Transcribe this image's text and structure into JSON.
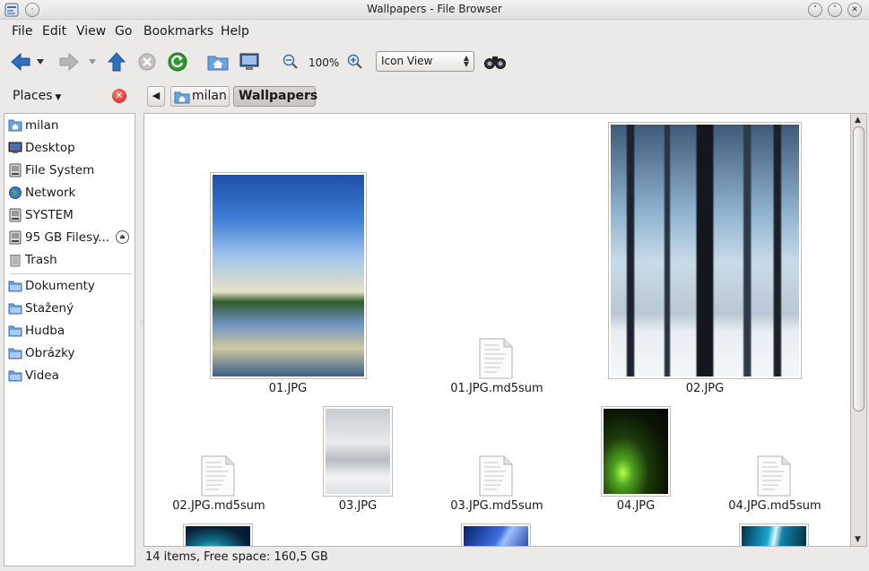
{
  "window": {
    "title": "Wallpapers - File Browser",
    "buttons": [
      "minimize",
      "maximize",
      "close"
    ]
  },
  "menubar": {
    "items": [
      "File",
      "Edit",
      "View",
      "Go",
      "Bookmarks",
      "Help"
    ]
  },
  "toolbar": {
    "zoom": "100%",
    "view_mode": "Icon View",
    "icons": [
      "back-icon",
      "back-history-icon",
      "forward-icon",
      "forward-history-icon",
      "up-icon",
      "stop-icon",
      "reload-icon",
      "home-icon",
      "computer-icon",
      "zoom-out-icon",
      "zoom-in-icon",
      "find-icon"
    ]
  },
  "places": {
    "header": "Places",
    "items": [
      {
        "label": "milan",
        "icon": "home-folder-icon"
      },
      {
        "label": "Desktop",
        "icon": "desktop-icon"
      },
      {
        "label": "File System",
        "icon": "drive-icon"
      },
      {
        "label": "Network",
        "icon": "network-icon"
      },
      {
        "label": "SYSTEM",
        "icon": "drive-icon"
      },
      {
        "label": "95 GB Filesy...",
        "icon": "drive-icon"
      },
      {
        "label": "Trash",
        "icon": "trash-icon"
      },
      {
        "label": "Dokumenty",
        "icon": "folder-icon"
      },
      {
        "label": "Stažený",
        "icon": "folder-icon"
      },
      {
        "label": "Hudba",
        "icon": "folder-icon"
      },
      {
        "label": "Obrázky",
        "icon": "folder-icon"
      },
      {
        "label": "Videa",
        "icon": "folder-icon"
      }
    ]
  },
  "breadcrumb": {
    "home": "milan",
    "current": "Wallpapers"
  },
  "files": [
    {
      "name": "01.JPG",
      "type": "image"
    },
    {
      "name": "01.JPG.md5sum",
      "type": "text"
    },
    {
      "name": "02.JPG",
      "type": "image"
    },
    {
      "name": "02.JPG.md5sum",
      "type": "text"
    },
    {
      "name": "03.JPG",
      "type": "image"
    },
    {
      "name": "03.JPG.md5sum",
      "type": "text"
    },
    {
      "name": "04.JPG",
      "type": "image"
    },
    {
      "name": "04.JPG.md5sum",
      "type": "text"
    }
  ],
  "status": "14 items, Free space: 160,5 GB",
  "colors": {
    "window_bg": "#eceae8",
    "folder": "#6ca2dc",
    "close_red": "#cc1a12",
    "reload_green": "#2a9a2a",
    "nav_blue": "#2f6fbf"
  }
}
